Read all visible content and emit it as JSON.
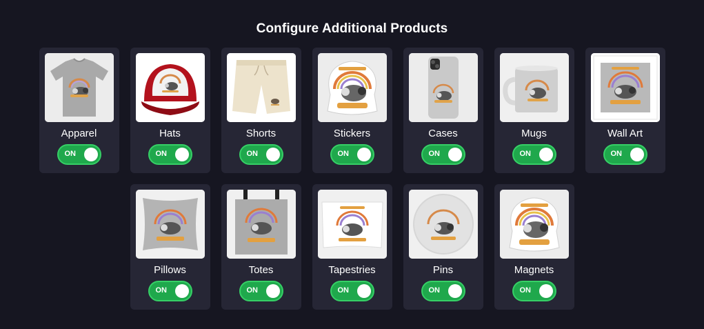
{
  "title": "Configure Additional Products",
  "colors": {
    "background": "#161621",
    "card": "#262635",
    "toggle_on": "#1fa84c"
  },
  "products_row1": [
    {
      "label": "Apparel",
      "toggle": "ON",
      "icon": "tshirt-product-icon"
    },
    {
      "label": "Hats",
      "toggle": "ON",
      "icon": "trucker-hat-product-icon"
    },
    {
      "label": "Shorts",
      "toggle": "ON",
      "icon": "shorts-product-icon"
    },
    {
      "label": "Stickers",
      "toggle": "ON",
      "icon": "sticker-product-icon"
    },
    {
      "label": "Cases",
      "toggle": "ON",
      "icon": "phone-case-product-icon"
    },
    {
      "label": "Mugs",
      "toggle": "ON",
      "icon": "mug-product-icon"
    },
    {
      "label": "Wall Art",
      "toggle": "ON",
      "icon": "framed-print-product-icon"
    }
  ],
  "products_row2": [
    {
      "label": "Pillows",
      "toggle": "ON",
      "icon": "pillow-product-icon"
    },
    {
      "label": "Totes",
      "toggle": "ON",
      "icon": "tote-bag-product-icon"
    },
    {
      "label": "Tapestries",
      "toggle": "ON",
      "icon": "tapestry-product-icon"
    },
    {
      "label": "Pins",
      "toggle": "ON",
      "icon": "pin-button-product-icon"
    },
    {
      "label": "Magnets",
      "toggle": "ON",
      "icon": "magnet-product-icon"
    }
  ]
}
